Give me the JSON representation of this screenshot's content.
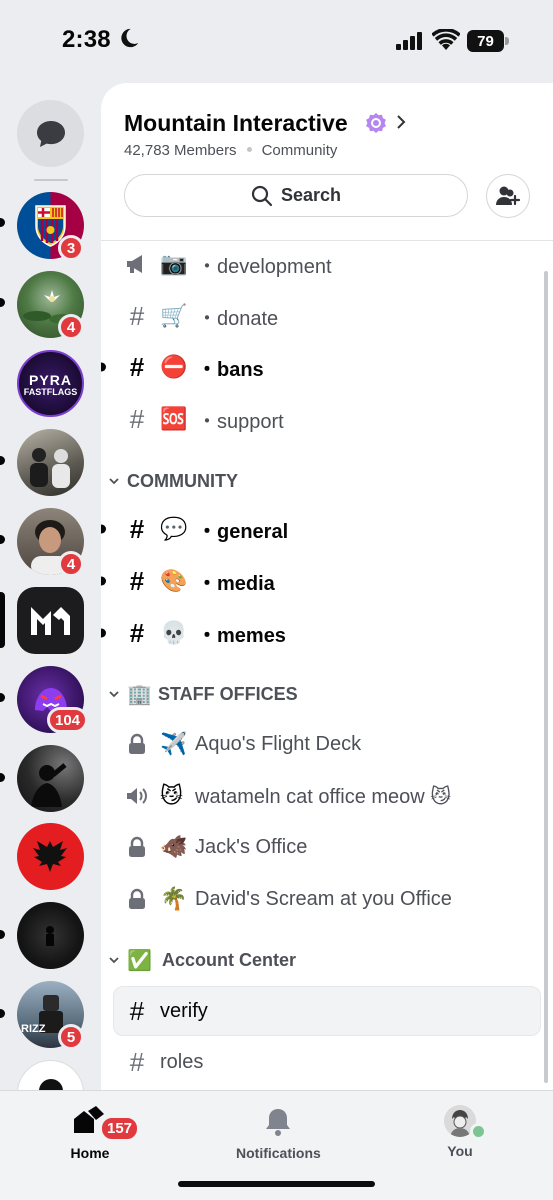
{
  "status_bar": {
    "time": "2:38",
    "battery": "79"
  },
  "rail": {
    "servers": [
      {
        "name": "FC Barcelona",
        "badge": "3",
        "color": "#a50044"
      },
      {
        "name": "Lily pond",
        "badge": "4",
        "color": "#3d6b35"
      },
      {
        "name": "Pyra Fastflags",
        "badge": "",
        "color": "#2a1747",
        "text_top": "PYRA",
        "text_bottom": "FASTFLAGS"
      },
      {
        "name": "Group photo",
        "badge": "",
        "color": "#6b6a63"
      },
      {
        "name": "Portrait",
        "badge": "4",
        "color": "#4a4541"
      },
      {
        "name": "Mountain Interactive",
        "badge": "",
        "color": "#1c1c1e",
        "selected": true
      },
      {
        "name": "Purple ghost",
        "badge": "104",
        "color": "#3a1a5e"
      },
      {
        "name": "Silhouette",
        "badge": "",
        "color": "#222"
      },
      {
        "name": "Eagle flag",
        "badge": "",
        "color": "#e41e20"
      },
      {
        "name": "Dark",
        "badge": "",
        "color": "#1a1a1a"
      },
      {
        "name": "Rizz",
        "badge": "5",
        "color": "#5d7080",
        "text": "RIZZ"
      }
    ]
  },
  "guild": {
    "name": "Mountain Interactive",
    "members": "42,783 Members",
    "type": "Community"
  },
  "search": {
    "label": "Search"
  },
  "channels_top": [
    {
      "icon": "megaphone-icon",
      "emoji": "📷",
      "name": "・development",
      "unread": false,
      "kind": "announcement"
    },
    {
      "icon": "hash-icon",
      "emoji": "🛒",
      "name": "・donate",
      "unread": false,
      "kind": "text"
    },
    {
      "icon": "hash-icon",
      "emoji": "⛔",
      "name": "・bans",
      "unread": true,
      "kind": "text"
    },
    {
      "icon": "hash-icon",
      "emoji": "🆘",
      "name": "・support",
      "unread": false,
      "kind": "text"
    }
  ],
  "categories": [
    {
      "label": "COMMUNITY",
      "emoji": ""
    },
    {
      "label": "STAFF OFFICES",
      "emoji": "🏢"
    },
    {
      "label": "Account Center",
      "emoji": "✅"
    }
  ],
  "community_channels": [
    {
      "emoji": "💬",
      "name": "・general",
      "unread": true
    },
    {
      "emoji": "🎨",
      "name": "・media",
      "unread": true
    },
    {
      "emoji": "💀",
      "name": "・memes",
      "unread": true
    }
  ],
  "staff_channels": [
    {
      "icon": "lock-icon",
      "emoji": "✈️",
      "name": "Aquo's Flight Deck"
    },
    {
      "icon": "speaker-icon",
      "emoji": "😼",
      "name": "watameln cat office meow 😼"
    },
    {
      "icon": "lock-icon",
      "emoji": "🐗",
      "name": "Jack's Office"
    },
    {
      "icon": "lock-icon",
      "emoji": "🌴",
      "name": "David's Scream at you Office"
    }
  ],
  "account_channels": [
    {
      "name": "verify",
      "selected": true
    },
    {
      "name": "roles",
      "selected": false
    }
  ],
  "tabs": {
    "home": {
      "label": "Home",
      "badge": "157"
    },
    "notifications": {
      "label": "Notifications"
    },
    "you": {
      "label": "You"
    }
  }
}
